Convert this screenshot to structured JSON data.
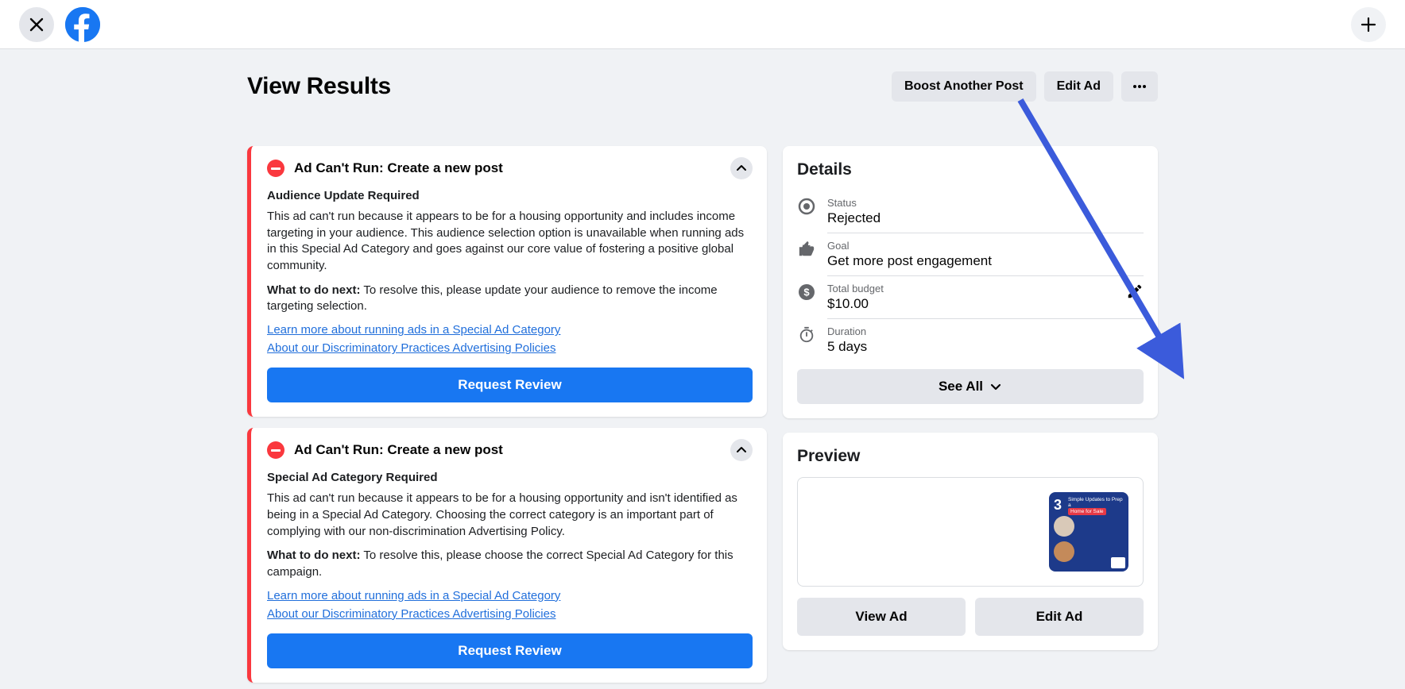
{
  "header": {
    "title": "View Results",
    "boost_label": "Boost Another Post",
    "edit_label": "Edit Ad"
  },
  "alerts": [
    {
      "title": "Ad Can't Run: Create a new post",
      "subtitle": "Audience Update Required",
      "body": "This ad can't run because it appears to be for a housing opportunity and includes income targeting in your audience. This audience selection option is unavailable when running ads in this Special Ad Category and goes against our core value of fostering a positive global community.",
      "next_label": "What to do next:",
      "next_text": " To resolve this, please update your audience to remove the income targeting selection.",
      "link1": "Learn more about running ads in a Special Ad Category",
      "link2": "About our Discriminatory Practices Advertising Policies",
      "button": "Request Review"
    },
    {
      "title": "Ad Can't Run: Create a new post",
      "subtitle": "Special Ad Category Required",
      "body": "This ad can't run because it appears to be for a housing opportunity and isn't identified as being in a Special Ad Category. Choosing the correct category is an important part of complying with our non-discrimination Advertising Policy.",
      "next_label": "What to do next:",
      "next_text": " To resolve this, please choose the correct Special Ad Category for this campaign.",
      "link1": "Learn more about running ads in a Special Ad Category",
      "link2": "About our Discriminatory Practices Advertising Policies",
      "button": "Request Review"
    }
  ],
  "details": {
    "heading": "Details",
    "status_label": "Status",
    "status_value": "Rejected",
    "goal_label": "Goal",
    "goal_value": "Get more post engagement",
    "budget_label": "Total budget",
    "budget_value": "$10.00",
    "duration_label": "Duration",
    "duration_value": "5 days",
    "see_all": "See All"
  },
  "preview": {
    "heading": "Preview",
    "thumb_num": "3",
    "thumb_line1": "Simple Updates to Prep a",
    "thumb_line2": "Home for Sale",
    "view_ad": "View Ad",
    "edit_ad": "Edit Ad"
  }
}
